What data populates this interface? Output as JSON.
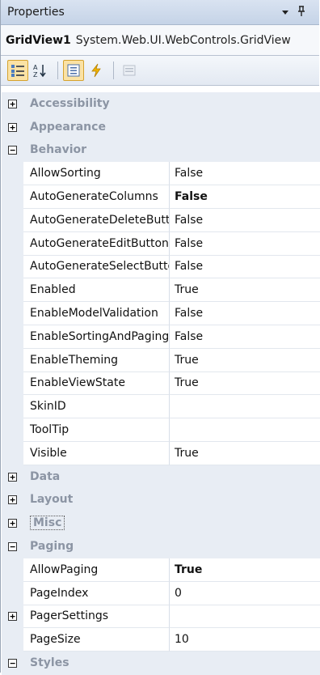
{
  "panel": {
    "title": "Properties",
    "title_icons": [
      "dropdown-arrow-icon",
      "pin-icon"
    ],
    "pin_glyph": "1",
    "object_name": "GridView1",
    "object_type": "System.Web.UI.WebControls.GridView"
  },
  "toolbar": {
    "buttons": [
      {
        "name": "categorized-icon",
        "active": true
      },
      {
        "name": "alphabetical-icon",
        "active": false
      },
      {
        "name": "properties-icon",
        "active": false
      },
      {
        "name": "events-icon",
        "active": false
      },
      {
        "name": "property-pages-icon",
        "active": false
      }
    ]
  },
  "categories": {
    "accessibility": "Accessibility",
    "appearance": "Appearance",
    "behavior": "Behavior",
    "data": "Data",
    "layout": "Layout",
    "misc": "Misc",
    "paging": "Paging",
    "styles": "Styles"
  },
  "behavior_props": [
    {
      "name": "AllowSorting",
      "value": "False"
    },
    {
      "name": "AutoGenerateColumns",
      "value": "False"
    },
    {
      "name": "AutoGenerateDeleteButton",
      "value": "False"
    },
    {
      "name": "AutoGenerateEditButton",
      "value": "False"
    },
    {
      "name": "AutoGenerateSelectButton",
      "value": "False"
    },
    {
      "name": "Enabled",
      "value": "True"
    },
    {
      "name": "EnableModelValidation",
      "value": "False"
    },
    {
      "name": "EnableSortingAndPagingCallbacks",
      "value": "False"
    },
    {
      "name": "EnableTheming",
      "value": "True"
    },
    {
      "name": "EnableViewState",
      "value": "True"
    },
    {
      "name": "SkinID",
      "value": ""
    },
    {
      "name": "ToolTip",
      "value": ""
    },
    {
      "name": "Visible",
      "value": "True"
    }
  ],
  "paging_props": [
    {
      "name": "AllowPaging",
      "value": "True"
    },
    {
      "name": "PageIndex",
      "value": "0"
    },
    {
      "name": "PagerSettings",
      "value": ""
    },
    {
      "name": "PageSize",
      "value": "10"
    }
  ],
  "expand_glyphs": {
    "collapsed": "+",
    "expanded": "−"
  }
}
